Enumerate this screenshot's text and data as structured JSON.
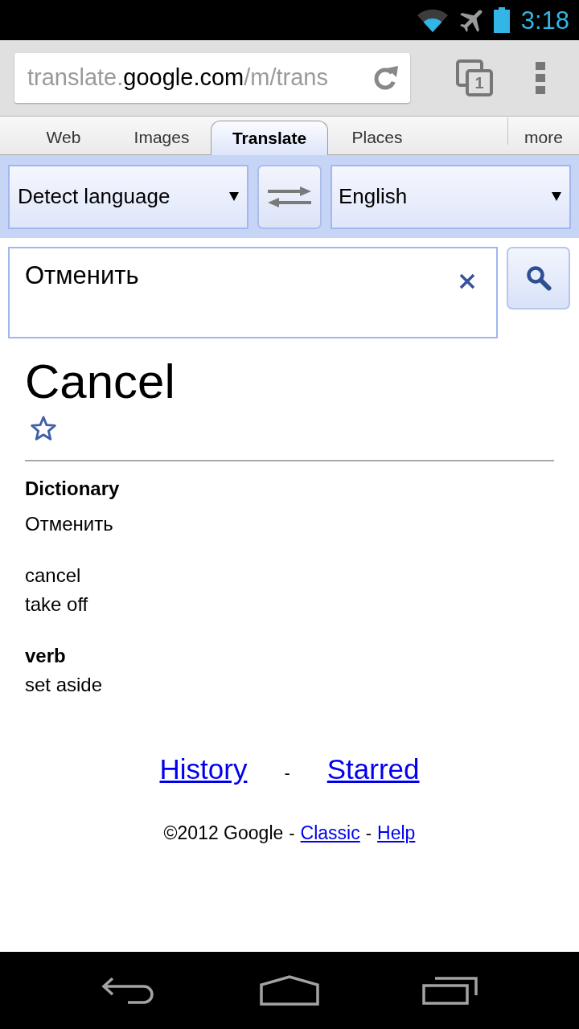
{
  "status_bar": {
    "time": "3:18"
  },
  "browser": {
    "url_parts": [
      {
        "text": "translate.",
        "highlighted": false
      },
      {
        "text": "google.com",
        "highlighted": true
      },
      {
        "text": "/m/trans",
        "highlighted": false
      }
    ],
    "tab_count": "1"
  },
  "nav_tabs": [
    {
      "label": "Web",
      "selected": false
    },
    {
      "label": "Images",
      "selected": false
    },
    {
      "label": "Translate",
      "selected": true
    },
    {
      "label": "Places",
      "selected": false
    }
  ],
  "more_link": "more",
  "language_bar": {
    "source": "Detect language",
    "target": "English"
  },
  "input": {
    "value": "Отменить"
  },
  "result": {
    "translation": "Cancel",
    "starred": false
  },
  "dictionary": {
    "title": "Dictionary",
    "headword": "Отменить",
    "groups": [
      {
        "terms": [
          "cancel",
          "take off"
        ]
      },
      {
        "part_of_speech": "verb",
        "terms": [
          "set aside"
        ]
      }
    ]
  },
  "footer": {
    "links": [
      {
        "kind": "link",
        "text": "History"
      },
      {
        "kind": "separator",
        "text": "-"
      },
      {
        "kind": "link",
        "text": "Starred"
      }
    ],
    "legal": [
      {
        "kind": "text",
        "text": "©2012 Google"
      },
      {
        "kind": "separator",
        "text": "-"
      },
      {
        "kind": "link",
        "text": "Classic"
      },
      {
        "kind": "separator",
        "text": "-"
      },
      {
        "kind": "link",
        "text": "Help"
      }
    ]
  }
}
